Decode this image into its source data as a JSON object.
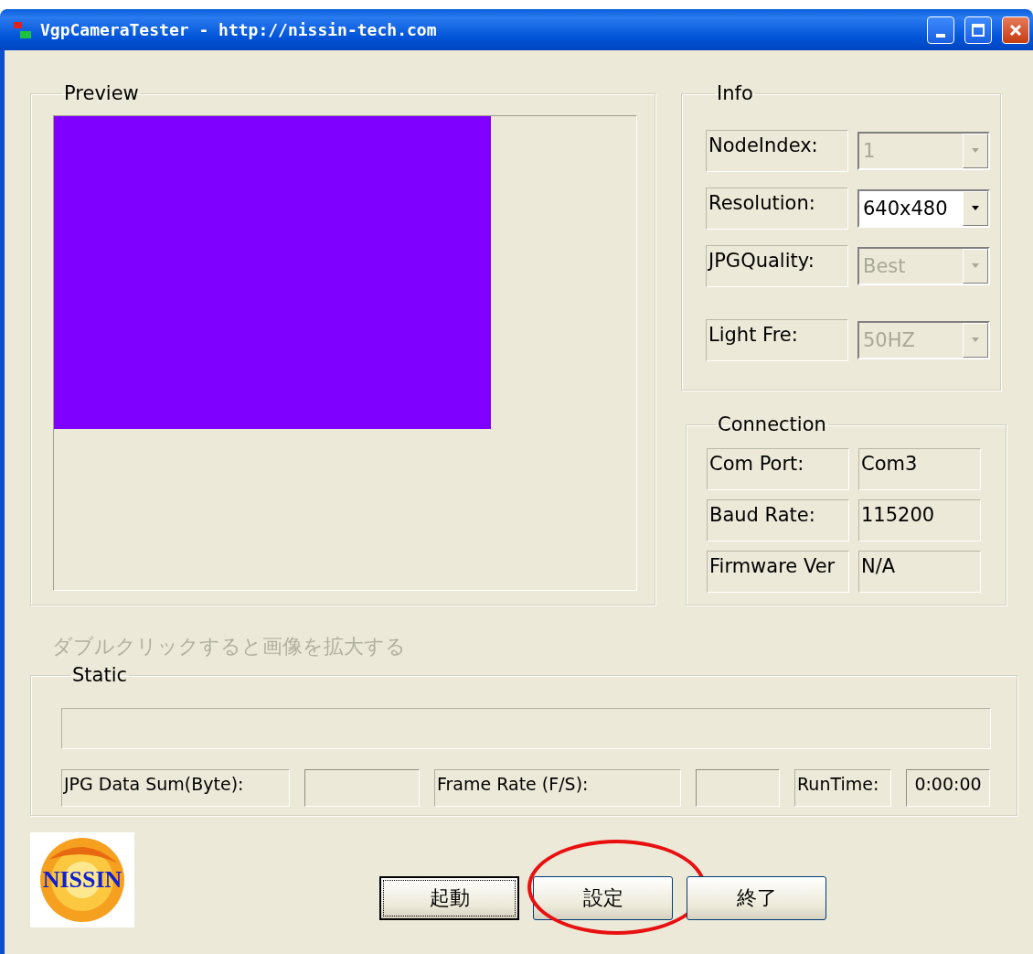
{
  "window": {
    "title": "VgpCameraTester - http://nissin-tech.com"
  },
  "preview": {
    "label": "Preview"
  },
  "info": {
    "label": "Info",
    "rows": [
      {
        "label": "NodeIndex:",
        "value": "1",
        "disabled": true
      },
      {
        "label": "Resolution:",
        "value": "640x480",
        "disabled": false
      },
      {
        "label": "JPGQuality:",
        "value": "Best",
        "disabled": true
      },
      {
        "label": "Light Fre:",
        "value": "50HZ",
        "disabled": true
      }
    ]
  },
  "connection": {
    "label": "Connection",
    "rows": [
      {
        "label": "Com Port:",
        "value": "Com3"
      },
      {
        "label": "Baud Rate:",
        "value": "115200"
      },
      {
        "label": "Firmware Ver",
        "value": "N/A"
      }
    ]
  },
  "hint": "ダブルクリックすると画像を拡大する",
  "static": {
    "label": "Static",
    "fields": [
      {
        "kind": "label",
        "text": "JPG Data Sum(Byte):"
      },
      {
        "kind": "value"
      },
      {
        "kind": "label",
        "text": "Frame Rate (F/S):"
      },
      {
        "kind": "value"
      },
      {
        "kind": "label",
        "text": "RunTime:"
      },
      {
        "kind": "value",
        "text": "0:00:00"
      }
    ]
  },
  "logo": {
    "text": "NISSIN"
  },
  "buttons": [
    {
      "label": "起動",
      "focused": true,
      "highlighted": false
    },
    {
      "label": "設定",
      "focused": false,
      "highlighted": true
    },
    {
      "label": "終了",
      "focused": false,
      "highlighted": false
    }
  ]
}
